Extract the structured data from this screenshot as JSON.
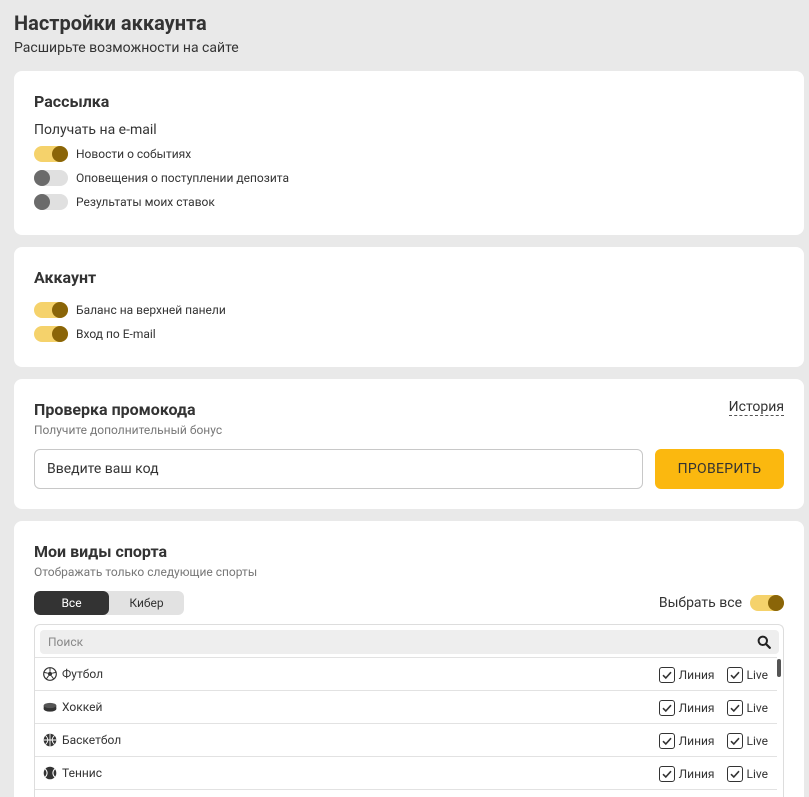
{
  "page": {
    "title": "Настройки аккаунта",
    "subtitle": "Расширьте возможности на сайте"
  },
  "newsletter": {
    "title": "Рассылка",
    "email_label": "Получать на e-mail",
    "toggles": [
      {
        "label": "Новости о событиях",
        "on": true
      },
      {
        "label": "Оповещения о поступлении депозита",
        "on": false
      },
      {
        "label": "Результаты моих ставок",
        "on": false
      }
    ]
  },
  "account": {
    "title": "Аккаунт",
    "toggles": [
      {
        "label": "Баланс на верхней панели",
        "on": true
      },
      {
        "label": "Вход по E-mail",
        "on": true
      }
    ]
  },
  "promo": {
    "title": "Проверка промокода",
    "subtitle": "Получите дополнительный бонус",
    "history_link": "История",
    "input_placeholder": "Введите ваш код",
    "check_button": "ПРОВЕРИТЬ"
  },
  "sports": {
    "title": "Мои виды спорта",
    "subtitle": "Отображать только следующие спорты",
    "tabs": [
      {
        "label": "Все",
        "active": true
      },
      {
        "label": "Кибер",
        "active": false
      }
    ],
    "select_all_label": "Выбрать все",
    "select_all_on": true,
    "search_placeholder": "Поиск",
    "line_label": "Линия",
    "live_label": "Live",
    "items": [
      {
        "name": "Футбол",
        "icon": "soccer-ball-icon",
        "line": true,
        "live": true
      },
      {
        "name": "Хоккей",
        "icon": "hockey-puck-icon",
        "line": true,
        "live": true
      },
      {
        "name": "Баскетбол",
        "icon": "basketball-icon",
        "line": true,
        "live": true
      },
      {
        "name": "Теннис",
        "icon": "tennis-ball-icon",
        "line": true,
        "live": true
      }
    ]
  },
  "colors": {
    "accent": "#fbb80f",
    "toggle_on_track": "#f5d26b",
    "toggle_on_knob": "#8a6508",
    "toggle_off_track": "#e0e0e0",
    "toggle_off_knob": "#6b6b6b",
    "background": "#e9e9e9"
  }
}
